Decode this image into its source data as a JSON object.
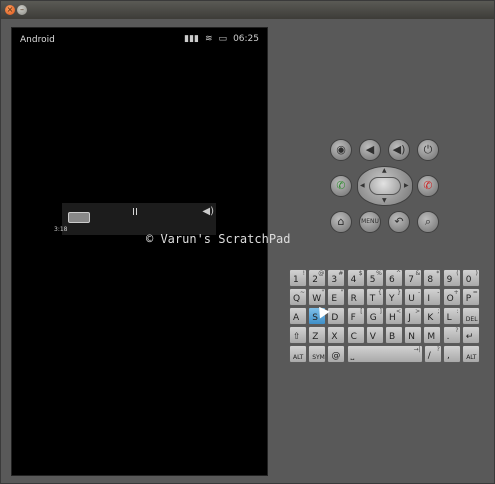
{
  "window": {
    "close_glyph": "×",
    "min_glyph": "–"
  },
  "status_bar": {
    "app_name": "Android",
    "signal_icon": "signal-bars-icon",
    "wifi_icon": "wifi-icon",
    "battery_icon": "battery-icon",
    "time": "06:25"
  },
  "media_controls": {
    "pause_glyph": "II",
    "volume_glyph": "◀)",
    "elapsed": "3:18"
  },
  "watermark": "© Varun's ScratchPad",
  "controls": {
    "camera": "◉",
    "vol_down": "◀",
    "vol_up": "◀)",
    "power": "⏻",
    "call": "✆",
    "end_call": "✆",
    "home": "⌂",
    "menu": "MENU",
    "back": "↶",
    "search": "⌕"
  },
  "keyboard": {
    "row1": [
      {
        "main": "1",
        "sub": "!"
      },
      {
        "main": "2",
        "sub": "@"
      },
      {
        "main": "3",
        "sub": "#"
      },
      {
        "main": "4",
        "sub": "$"
      },
      {
        "main": "5",
        "sub": "%"
      },
      {
        "main": "6",
        "sub": "^"
      },
      {
        "main": "7",
        "sub": "&"
      },
      {
        "main": "8",
        "sub": "*"
      },
      {
        "main": "9",
        "sub": "("
      },
      {
        "main": "0",
        "sub": ")"
      }
    ],
    "row2": [
      {
        "main": "Q",
        "sub": "~"
      },
      {
        "main": "W",
        "sub": "\""
      },
      {
        "main": "E",
        "sub": "\""
      },
      {
        "main": "R",
        "sub": ""
      },
      {
        "main": "T",
        "sub": "{"
      },
      {
        "main": "Y",
        "sub": "}"
      },
      {
        "main": "U",
        "sub": "-"
      },
      {
        "main": "I",
        "sub": "-"
      },
      {
        "main": "O",
        "sub": "+"
      },
      {
        "main": "P",
        "sub": "="
      }
    ],
    "row3": [
      {
        "main": "A",
        "sub": ""
      },
      {
        "main": "S",
        "sub": "\\"
      },
      {
        "main": "D",
        "sub": ""
      },
      {
        "main": "F",
        "sub": "["
      },
      {
        "main": "G",
        "sub": "]"
      },
      {
        "main": "H",
        "sub": "<"
      },
      {
        "main": "J",
        "sub": ">"
      },
      {
        "main": "K",
        "sub": ";"
      },
      {
        "main": "L",
        "sub": ":"
      },
      {
        "main": "DEL",
        "sub": ""
      }
    ],
    "row4": [
      {
        "main": "⇧",
        "sub": ""
      },
      {
        "main": "Z",
        "sub": ""
      },
      {
        "main": "X",
        "sub": ""
      },
      {
        "main": "C",
        "sub": ""
      },
      {
        "main": "V",
        "sub": ""
      },
      {
        "main": "B",
        "sub": ""
      },
      {
        "main": "N",
        "sub": ""
      },
      {
        "main": "M",
        "sub": ""
      },
      {
        "main": ".",
        "sub": "?"
      },
      {
        "main": "↵",
        "sub": ""
      }
    ],
    "row5": [
      {
        "main": "ALT",
        "sub": ""
      },
      {
        "main": "SYM",
        "sub": ""
      },
      {
        "main": "@",
        "sub": ""
      },
      {
        "main": "⎵",
        "sub": "→|"
      },
      {
        "main": "/",
        "sub": "?"
      },
      {
        "main": ",",
        "sub": ""
      },
      {
        "main": "ALT",
        "sub": ""
      }
    ]
  }
}
